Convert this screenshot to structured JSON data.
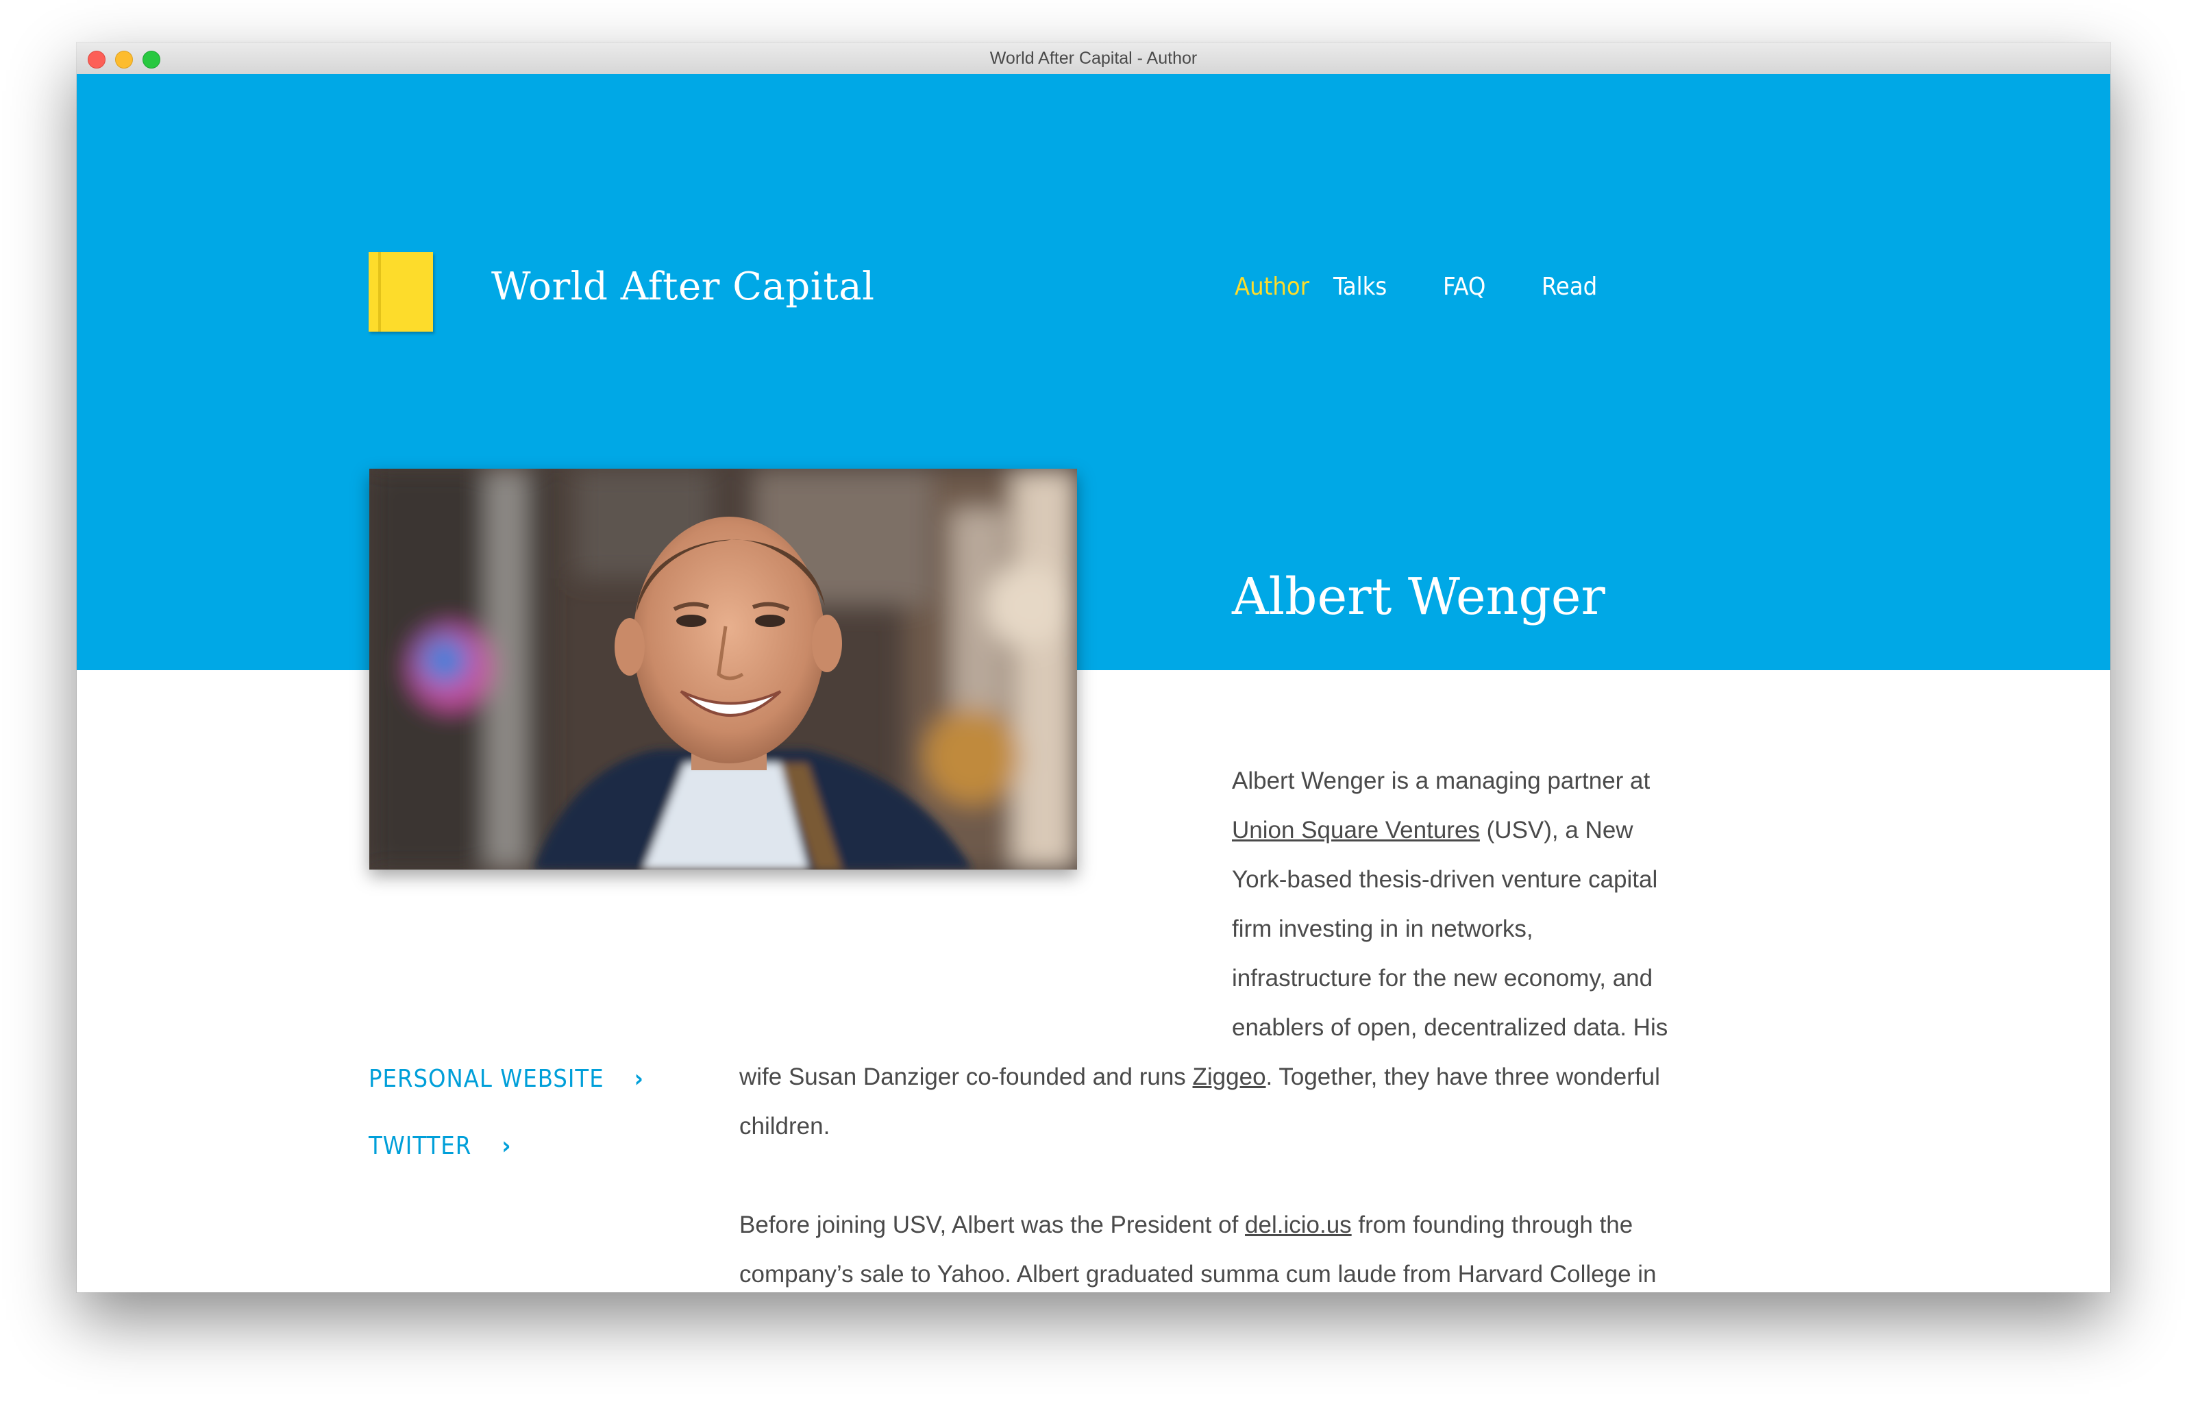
{
  "window": {
    "title": "World After Capital - Author"
  },
  "brand": {
    "name": "World After Capital",
    "logo_icon": "book-icon",
    "accent": "#00a8e6",
    "highlight": "#fddc2b"
  },
  "nav": {
    "items": [
      {
        "label": "Author",
        "active": true
      },
      {
        "label": "Talks",
        "active": false
      },
      {
        "label": "FAQ",
        "active": false
      },
      {
        "label": "Read",
        "active": false
      }
    ]
  },
  "author": {
    "name": "Albert Wenger",
    "photo_alt": "Portrait photo"
  },
  "links": [
    {
      "label": "PERSONAL WEBSITE",
      "icon": "chevron-right-icon"
    },
    {
      "label": "TWITTER",
      "icon": "chevron-right-icon"
    }
  ],
  "bio": {
    "p1": {
      "l1": "Albert Wenger is a managing partner at",
      "usv": "Union Square Ventures",
      "l2_rest": " (USV), a New",
      "l3": "York-based thesis-driven venture capital",
      "l4": "firm investing in in networks,",
      "l5": "infrastructure for the new economy, and",
      "l6": "enablers of open, decentralized data. His",
      "l7_start": "wife Susan Danziger co-founded and runs ",
      "ziggeo": "Ziggeo",
      "l7_end": ". Together, they have three wonderful",
      "l8": "children."
    },
    "p2": {
      "l1_start": "Before joining USV, Albert was the President of ",
      "delicious": "del.icio.us",
      "l1_end": " from founding through the",
      "l2": "company’s sale to Yahoo. Albert graduated summa cum laude from Harvard College in"
    }
  }
}
